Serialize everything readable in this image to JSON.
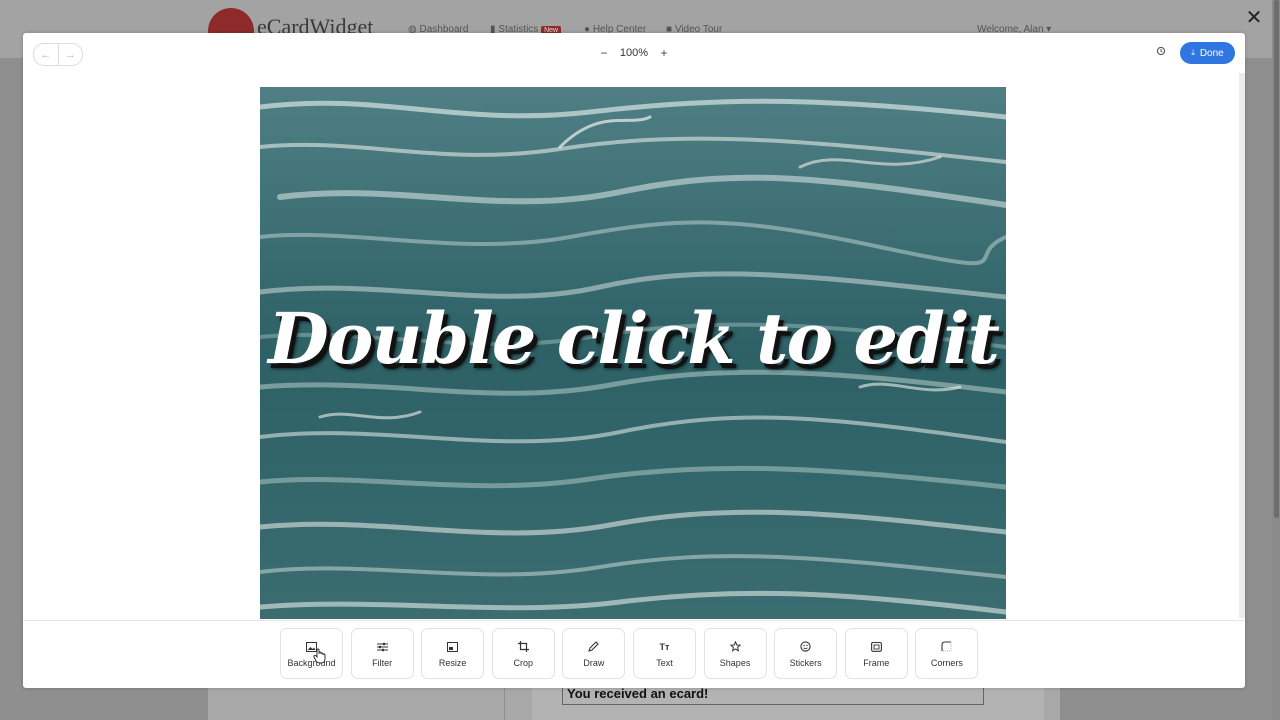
{
  "background_page": {
    "logo_text": "eCardWidget",
    "nav": [
      {
        "label": "Dashboard"
      },
      {
        "label": "Statistics",
        "badge": "New"
      },
      {
        "label": "Help Center"
      },
      {
        "label": "Video Tour"
      }
    ],
    "welcome": "Welcome, Alan",
    "card_subject": "You received an ecard!"
  },
  "editor": {
    "zoom": {
      "value": "100%",
      "minus": "−",
      "plus": "+"
    },
    "done_label": "Done",
    "canvas_text": "Double click to edit",
    "tools": [
      {
        "label": "Background",
        "icon": "image-icon"
      },
      {
        "label": "Filter",
        "icon": "sliders-icon"
      },
      {
        "label": "Resize",
        "icon": "resize-icon"
      },
      {
        "label": "Crop",
        "icon": "crop-icon"
      },
      {
        "label": "Draw",
        "icon": "pen-icon"
      },
      {
        "label": "Text",
        "icon": "text-icon"
      },
      {
        "label": "Shapes",
        "icon": "shapes-icon"
      },
      {
        "label": "Stickers",
        "icon": "sticker-icon"
      },
      {
        "label": "Frame",
        "icon": "frame-icon"
      },
      {
        "label": "Corners",
        "icon": "corners-icon"
      }
    ]
  },
  "colors": {
    "accent": "#2f76e0",
    "water_dark": "#1f4e52",
    "water_light": "#d9e4e2"
  }
}
